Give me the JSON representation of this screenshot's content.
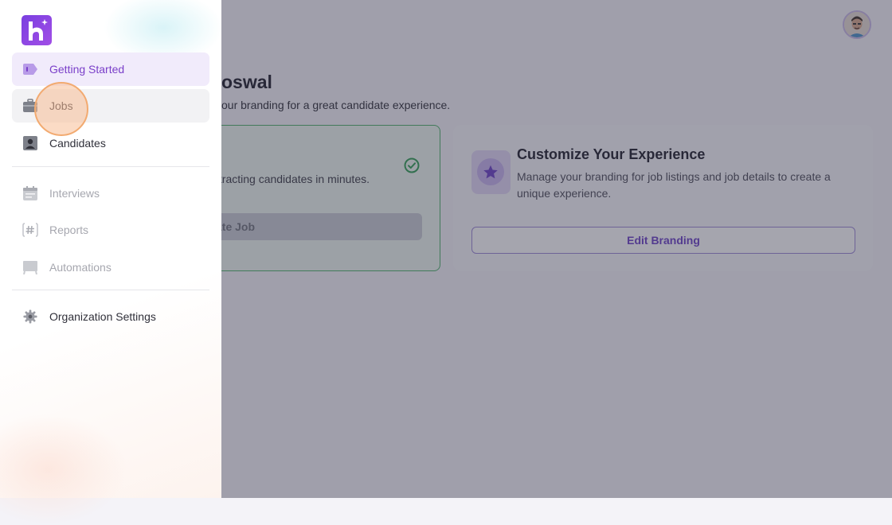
{
  "header": {
    "avatar_icon": "user-avatar"
  },
  "main": {
    "heading": "oswal",
    "subheading": "our branding for a great candidate experience.",
    "create_card": {
      "description": "ttracting candidates in minutes.",
      "button_label": "ate Job",
      "status_icon": "check-circle-icon"
    },
    "brand_card": {
      "title": "Customize Your Experience",
      "description": "Manage your branding for job listings and job details to create a unique experience.",
      "button_label": "Edit Branding",
      "icon": "star-icon"
    }
  },
  "sidebar": {
    "logo": "h-logo",
    "items": [
      {
        "label": "Getting Started",
        "icon": "tag-icon",
        "state": "active"
      },
      {
        "label": "Jobs",
        "icon": "briefcase-icon",
        "state": "hover"
      },
      {
        "label": "Candidates",
        "icon": "user-card-icon",
        "state": "normal"
      },
      {
        "label": "Interviews",
        "icon": "calendar-icon",
        "state": "muted"
      },
      {
        "label": "Reports",
        "icon": "hash-icon",
        "state": "muted"
      },
      {
        "label": "Automations",
        "icon": "presentation-icon",
        "state": "muted"
      },
      {
        "label": "Organization Settings",
        "icon": "gear-icon",
        "state": "normal"
      }
    ]
  },
  "colors": {
    "accent": "#7a3fc9",
    "success": "#4bb168",
    "brand_button_text": "#6a3fc7"
  }
}
